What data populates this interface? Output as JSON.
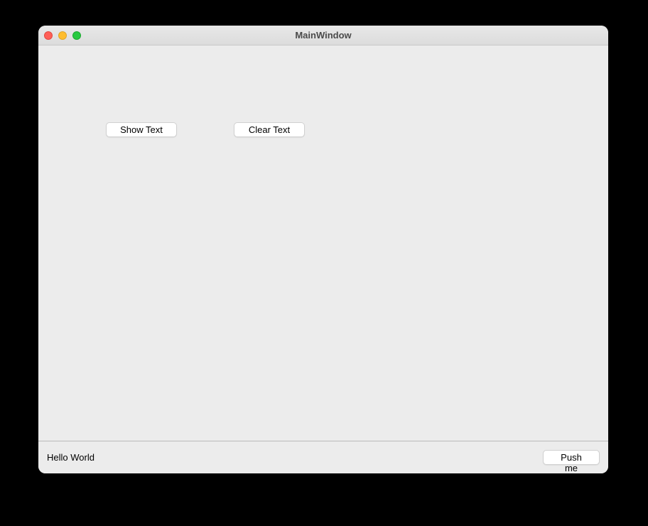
{
  "window": {
    "title": "MainWindow"
  },
  "buttons": {
    "show_text": "Show Text",
    "clear_text": "Clear Text",
    "push_me": "Push me"
  },
  "statusbar": {
    "message": "Hello World"
  }
}
